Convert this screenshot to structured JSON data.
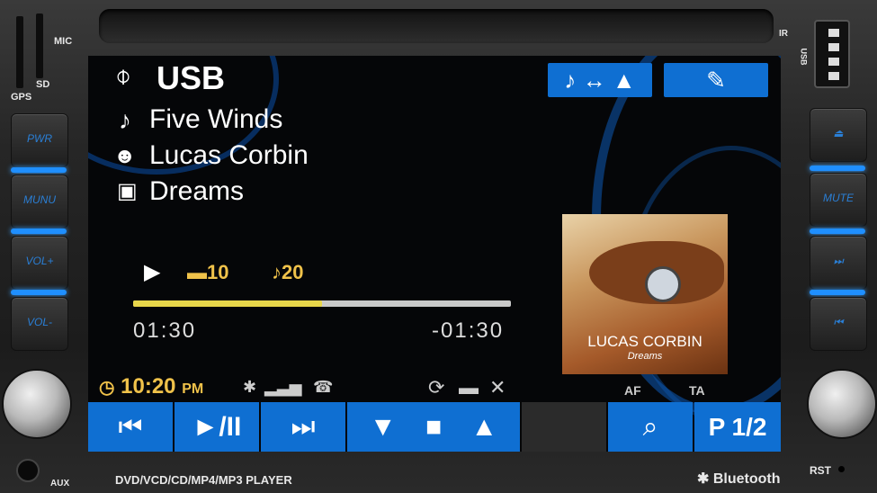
{
  "device": {
    "mic_label": "MIC",
    "sd_label": "SD",
    "gps_label": "GPS",
    "ir_label": "IR",
    "usb_port_label": "USB",
    "aux_label": "AUX",
    "rst_label": "RST",
    "model_label": "DVD/VCD/CD/MP4/MP3 PLAYER",
    "bluetooth_label": "Bluetooth",
    "left_buttons": [
      "PWR",
      "MUNU",
      "VOL+",
      "VOL-"
    ],
    "right_buttons": [
      "eject-icon",
      "MUTE",
      "next-icon",
      "prev-icon"
    ],
    "mute_label": "MUTE"
  },
  "screen": {
    "source": "USB",
    "track_title": "Five Winds",
    "artist": "Lucas Corbin",
    "album": "Dreams",
    "folder_number": "10",
    "track_number": "20",
    "elapsed": "01:30",
    "remaining": "-01:30",
    "progress": 0.5,
    "clock_time": "10:20",
    "clock_ampm": "PM",
    "af_label": "AF",
    "ta_label": "TA",
    "album_art_artist": "LUCAS CORBIN",
    "album_art_title": "Dreams",
    "page_label": "P 1/2",
    "play_pause_label": "►/II"
  },
  "colors": {
    "accent_blue": "#0f6fd2",
    "highlight_yellow": "#f0c24a",
    "progress_fill": "#e8d64a",
    "side_glow": "#1f8fff"
  }
}
